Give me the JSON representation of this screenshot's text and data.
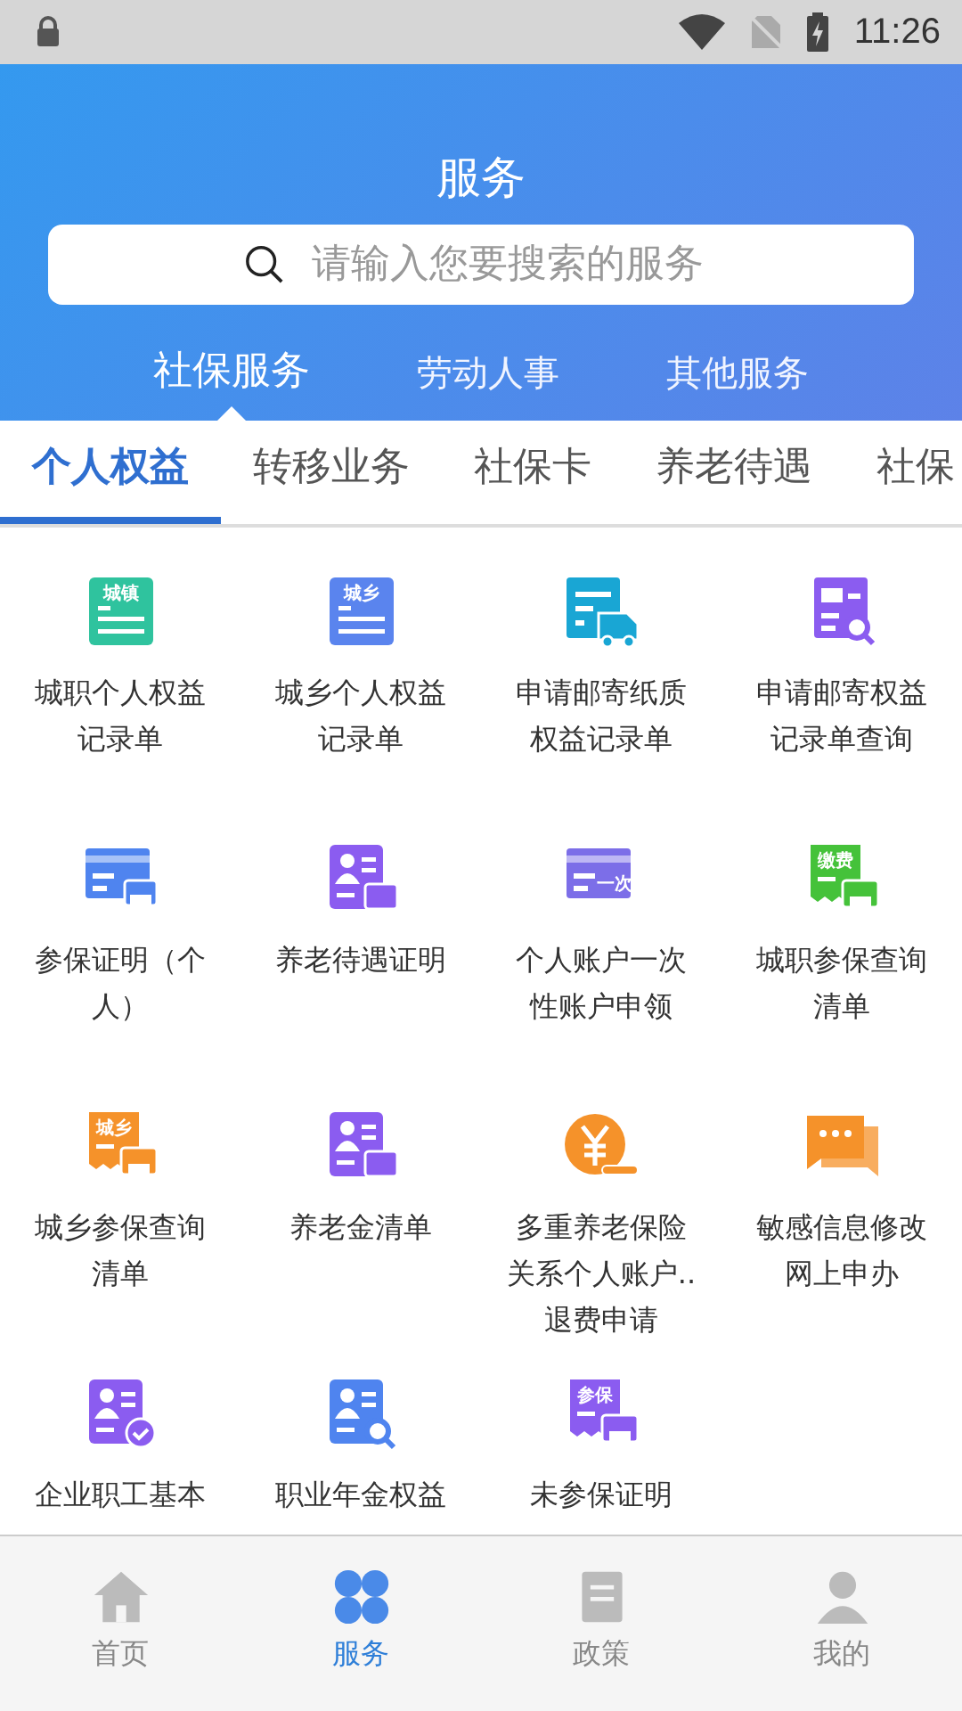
{
  "status_bar": {
    "time": "11:26"
  },
  "header": {
    "title": "服务",
    "search": {
      "placeholder": "请输入您要搜索的服务"
    },
    "tabs": [
      {
        "label": "社保服务",
        "selected": true
      },
      {
        "label": "劳动人事",
        "selected": false
      },
      {
        "label": "其他服务",
        "selected": false
      }
    ]
  },
  "sub_tabs": [
    {
      "label": "个人权益",
      "selected": true
    },
    {
      "label": "转移业务",
      "selected": false
    },
    {
      "label": "社保卡",
      "selected": false
    },
    {
      "label": "养老待遇",
      "selected": false
    },
    {
      "label": "社保",
      "selected": false
    }
  ],
  "services": [
    {
      "label": "城职个人权益记录单",
      "kind": "tag-doc",
      "tag": "城镇",
      "color": "#2fc39e"
    },
    {
      "label": "城乡个人权益记录单",
      "kind": "tag-doc",
      "tag": "城乡",
      "color": "#5a84ee"
    },
    {
      "label": "申请邮寄纸质权益记录单",
      "kind": "truck",
      "color": "#19a6d4"
    },
    {
      "label": "申请邮寄权益记录单查询",
      "kind": "doc-search",
      "color": "#8b5cf0"
    },
    {
      "label": "参保证明（个人）",
      "kind": "card-printer",
      "color": "#4f84ef"
    },
    {
      "label": "养老待遇证明",
      "kind": "person-printer",
      "color": "#8b5cf0"
    },
    {
      "label": "个人账户一次性账户申领",
      "kind": "tag-card",
      "tag": "一次",
      "color": "#7c6ee8"
    },
    {
      "label": "城职参保查询清单",
      "kind": "tag-printer",
      "tag": "缴费",
      "color": "#45c23a"
    },
    {
      "label": "城乡参保查询清单",
      "kind": "tag-printer",
      "tag": "城乡",
      "color": "#f5922a"
    },
    {
      "label": "养老金清单",
      "kind": "person-printer",
      "color": "#8b5cf0"
    },
    {
      "label": "多重养老保险关系个人账户..退费申请",
      "kind": "yuan",
      "color": "#f5922a"
    },
    {
      "label": "敏感信息修改网上申办",
      "kind": "chat",
      "color": "#f5922a"
    },
    {
      "label": "企业职工基本",
      "kind": "person-check",
      "color": "#8b5cf0"
    },
    {
      "label": "职业年金权益",
      "kind": "person-search",
      "color": "#4f84ef"
    },
    {
      "label": "未参保证明",
      "kind": "tag-x-printer",
      "tag": "参保",
      "color": "#8b5cf0"
    }
  ],
  "bottom_nav": [
    {
      "label": "首页",
      "kind": "home",
      "selected": false
    },
    {
      "label": "服务",
      "kind": "service",
      "selected": true
    },
    {
      "label": "政策",
      "kind": "policy",
      "selected": false
    },
    {
      "label": "我的",
      "kind": "me",
      "selected": false
    }
  ]
}
